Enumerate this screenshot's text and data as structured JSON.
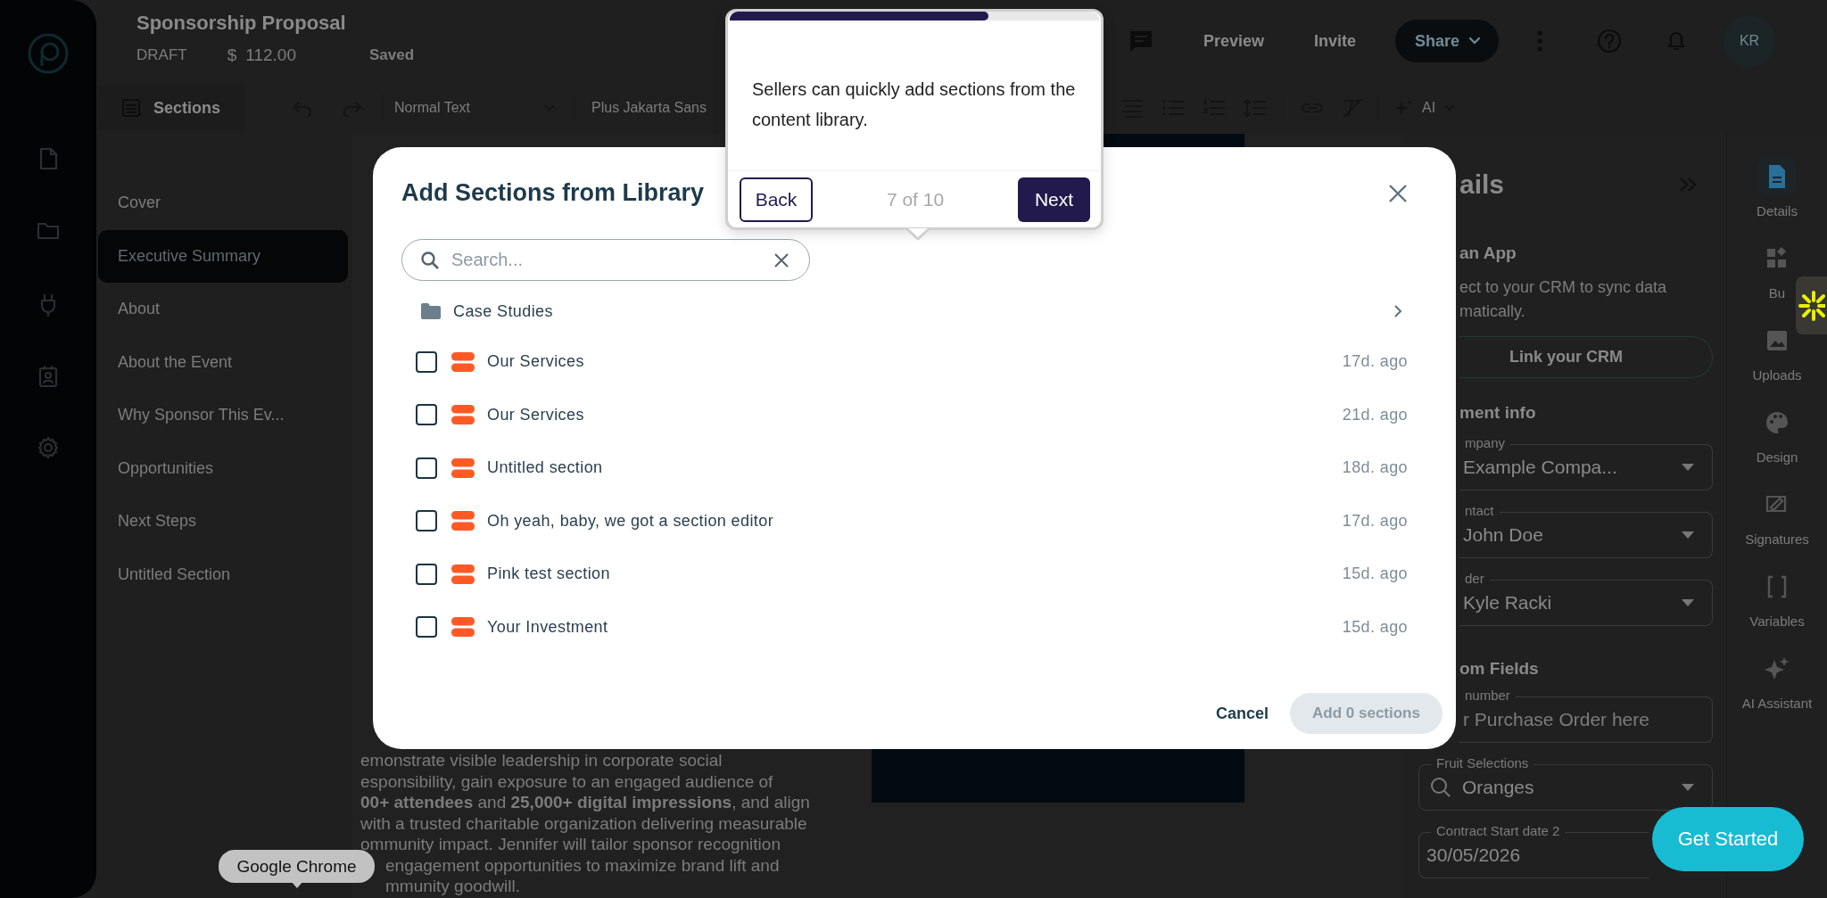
{
  "header": {
    "title": "Sponsorship Proposal",
    "status": "DRAFT",
    "currency": "$",
    "amount": "112.00",
    "save_state": "Saved",
    "actions": [
      "Preview",
      "Invite"
    ],
    "share": "Share",
    "avatar": "KR"
  },
  "toolbar": {
    "sections_button": "Sections",
    "text_style": "Normal Text",
    "font": "Plus Jakarta Sans",
    "ai": "AI"
  },
  "sections": [
    {
      "label": "Cover",
      "selected": false
    },
    {
      "label": "Executive Summary",
      "selected": true
    },
    {
      "label": "About",
      "selected": false
    },
    {
      "label": "About the Event",
      "selected": false
    },
    {
      "label": "Why Sponsor This Ev...",
      "selected": false
    },
    {
      "label": "Opportunities",
      "selected": false
    },
    {
      "label": "Next Steps",
      "selected": false
    },
    {
      "label": "Untitled Section",
      "selected": false
    }
  ],
  "document": {
    "lines": [
      "emonstrate visible leadership in corporate social",
      "esponsibility, gain exposure to an engaged audience of",
      "**00+ attendees** and **25,000+ digital impressions**, and align",
      "with a trusted charitable organization delivering measurable",
      "ommunity impact. Jennifer will tailor sponsor recognition",
      "engagement opportunities to maximize brand lift and",
      "mmunity goodwill."
    ]
  },
  "details": {
    "heading": "ails",
    "app_title": "an App",
    "app_text": [
      "ect to your CRM to sync data",
      "matically."
    ],
    "crm_button": "Link your CRM",
    "info_heading": "ment info",
    "fields": [
      {
        "kind": "select",
        "label": "mpany",
        "value": "Example Compa..."
      },
      {
        "kind": "select",
        "label": "ntact",
        "value": "John Doe"
      },
      {
        "kind": "select",
        "label": "der",
        "value": "Kyle Racki"
      }
    ],
    "custom_heading": "om Fields",
    "custom_fields": [
      {
        "kind": "text",
        "label": "number",
        "placeholder": "r Purchase Order here"
      },
      {
        "kind": "search-select",
        "label": "Fruit Selections",
        "value": "Oranges"
      },
      {
        "kind": "date",
        "label": "Contract Start date 2",
        "value": "30/05/2026"
      }
    ]
  },
  "tool_rail": [
    {
      "kind": "details",
      "label": "Details",
      "selected": true
    },
    {
      "kind": "blocks",
      "label": "Bu",
      "selected": false
    },
    {
      "kind": "uploads",
      "label": "Uploads",
      "selected": false
    },
    {
      "kind": "design",
      "label": "Design",
      "selected": false
    },
    {
      "kind": "signatures",
      "label": "Signatures",
      "selected": false
    },
    {
      "kind": "variables",
      "label": "Variables",
      "selected": false
    },
    {
      "kind": "ai",
      "label": "AI Assistant",
      "selected": false
    }
  ],
  "modal": {
    "title": "Add Sections from Library",
    "search": {
      "placeholder": "Search..."
    },
    "folders": [
      {
        "label": "Case Studies"
      }
    ],
    "items": [
      {
        "name": "Our Services",
        "age": "17d. ago",
        "checked": false
      },
      {
        "name": "Our Services",
        "age": "21d. ago",
        "checked": false
      },
      {
        "name": "Untitled section",
        "age": "18d. ago",
        "checked": false
      },
      {
        "name": "Oh yeah, baby, we got a section editor",
        "age": "17d. ago",
        "checked": false
      },
      {
        "name": "Pink test section",
        "age": "15d. ago",
        "checked": false
      },
      {
        "name": "Your Investment",
        "age": "15d. ago",
        "checked": false
      }
    ],
    "cancel": "Cancel",
    "add_button": {
      "label": "Add 0 sections",
      "disabled": true
    }
  },
  "tour": {
    "level": 0.7,
    "text": "Sellers can quickly add sections from the content library.",
    "back": "Back",
    "step": "7 of 10",
    "next": "Next"
  },
  "get_started": "Get Started",
  "tooltip": "Google Chrome"
}
